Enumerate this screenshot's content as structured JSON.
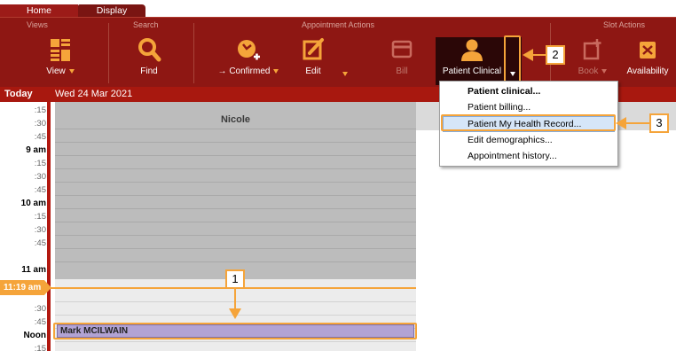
{
  "tabs": [
    {
      "label": "Home"
    },
    {
      "label": "Display"
    }
  ],
  "ribbon": {
    "groups": {
      "views": "Views",
      "search": "Search",
      "appointment_actions": "Appointment Actions",
      "slot_actions": "Slot Actions"
    },
    "buttons": {
      "view": "View",
      "find": "Find",
      "confirmed": "→ Confirmed",
      "edit": "Edit",
      "bill": "Bill",
      "patient_clinical": "Patient Clinical",
      "book": "Book",
      "availability": "Availability"
    }
  },
  "datebar": {
    "today": "Today",
    "date": "Wed 24 Mar 2021"
  },
  "time_slots": [
    ":15",
    ":30",
    ":45",
    "9 am",
    ":15",
    ":30",
    ":45",
    "10 am",
    ":15",
    ":30",
    ":45",
    "11 am",
    "11:19 am",
    ":30",
    ":45",
    "Noon",
    ":15"
  ],
  "now_marker": "11:19 am",
  "schedule": {
    "provider": "Nicole",
    "appointment": "Mark MCILWAIN"
  },
  "menu": {
    "items": [
      {
        "label": "Patient clinical..."
      },
      {
        "label": "Patient billing..."
      },
      {
        "label": "Patient My Health Record..."
      },
      {
        "label": "Edit demographics..."
      },
      {
        "label": "Appointment history..."
      }
    ]
  },
  "callouts": [
    "1",
    "2",
    "3"
  ],
  "colors": {
    "ribbon": "#8e1713",
    "accent": "#f5a43a",
    "datebar": "#a8180f",
    "appointment": "#b2a3d4"
  }
}
